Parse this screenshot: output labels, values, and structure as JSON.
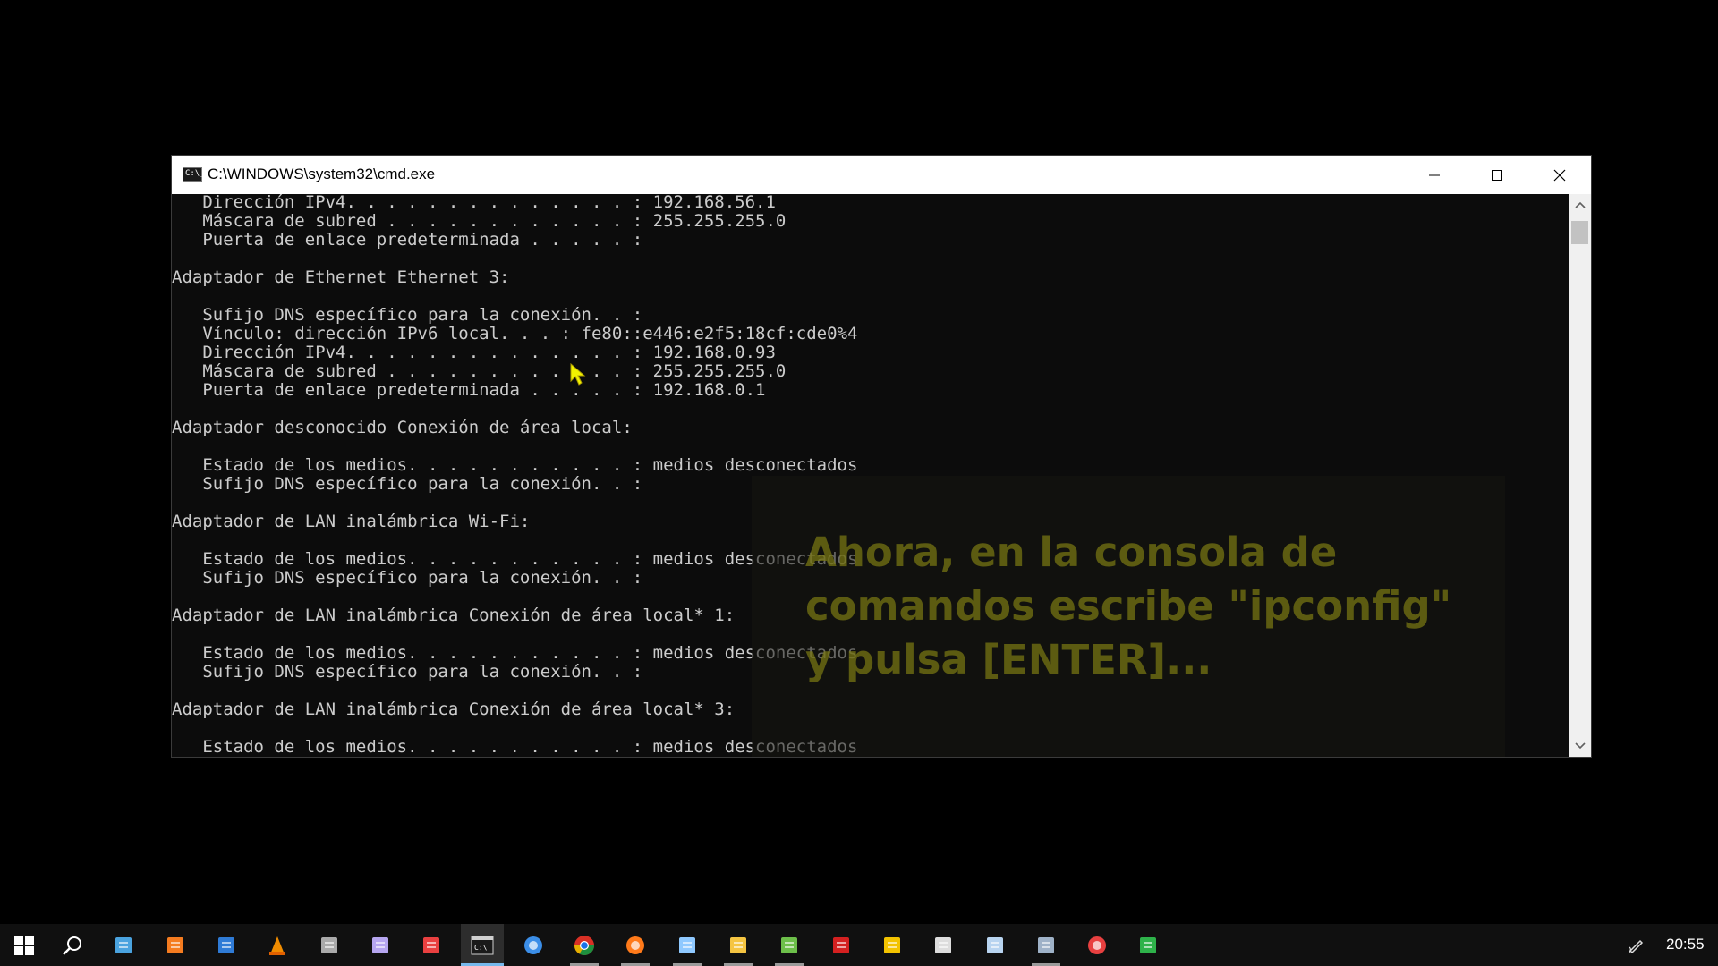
{
  "window": {
    "title": "C:\\WINDOWS\\system32\\cmd.exe",
    "icon_text": "C:\\_"
  },
  "console": {
    "lines": [
      "   Dirección IPv4. . . . . . . . . . . . . . : 192.168.56.1",
      "   Máscara de subred . . . . . . . . . . . . : 255.255.255.0",
      "   Puerta de enlace predeterminada . . . . . :",
      "",
      "Adaptador de Ethernet Ethernet 3:",
      "",
      "   Sufijo DNS específico para la conexión. . :",
      "   Vínculo: dirección IPv6 local. . . : fe80::e446:e2f5:18cf:cde0%4",
      "   Dirección IPv4. . . . . . . . . . . . . . : 192.168.0.93",
      "   Máscara de subred . . . . . . . . . . . . : 255.255.255.0",
      "   Puerta de enlace predeterminada . . . . . : 192.168.0.1",
      "",
      "Adaptador desconocido Conexión de área local:",
      "",
      "   Estado de los medios. . . . . . . . . . . : medios desconectados",
      "   Sufijo DNS específico para la conexión. . :",
      "",
      "Adaptador de LAN inalámbrica Wi-Fi:",
      "",
      "   Estado de los medios. . . . . . . . . . . : medios desconectados",
      "   Sufijo DNS específico para la conexión. . :",
      "",
      "Adaptador de LAN inalámbrica Conexión de área local* 1:",
      "",
      "   Estado de los medios. . . . . . . . . . . : medios desconectados",
      "   Sufijo DNS específico para la conexión. . :",
      "",
      "Adaptador de LAN inalámbrica Conexión de área local* 3:",
      "",
      "   Estado de los medios. . . . . . . . . . . : medios desconectados"
    ]
  },
  "overlay": {
    "caption_line1": "Ahora, en la consola de",
    "caption_line2": "comandos escribe \"ipconfig\"",
    "caption_line3": "y pulsa [ENTER]..."
  },
  "taskbar": {
    "items": [
      {
        "name": "start-icon",
        "color": "#ffffff"
      },
      {
        "name": "search-icon",
        "color": "#ffffff"
      },
      {
        "name": "explorer-app-icon",
        "color": "#4aa3df"
      },
      {
        "name": "xampp-icon",
        "color": "#f57c20"
      },
      {
        "name": "visual-studio-code-icon",
        "color": "#2f7bd6"
      },
      {
        "name": "vlc-icon",
        "color": "#f08c00"
      },
      {
        "name": "link-app-icon",
        "color": "#aaaaaa"
      },
      {
        "name": "vs-app-icon",
        "color": "#b6a6f0"
      },
      {
        "name": "bluetooth-app-icon",
        "color": "#e94040"
      },
      {
        "name": "cmd-icon",
        "color": "#d0d0d0"
      },
      {
        "name": "edge-app-icon",
        "color": "#3b8ee8"
      },
      {
        "name": "chrome-icon",
        "color": "#e6b000"
      },
      {
        "name": "firefox-icon",
        "color": "#ff7a1a"
      },
      {
        "name": "snipping-tool-icon",
        "color": "#8fc9ff"
      },
      {
        "name": "file-explorer-icon",
        "color": "#f5c542"
      },
      {
        "name": "notepad-app-icon",
        "color": "#6dbf4a"
      },
      {
        "name": "red-app-icon",
        "color": "#d42020"
      },
      {
        "name": "sticky-notes-icon",
        "color": "#f3c300"
      },
      {
        "name": "hammer-app-icon",
        "color": "#dddddd"
      },
      {
        "name": "virtualbox-icon",
        "color": "#b8d4f0"
      },
      {
        "name": "screenshot-app-icon",
        "color": "#9fb2c8"
      },
      {
        "name": "clock-app-icon",
        "color": "#e84040"
      },
      {
        "name": "spreadsheet-app-icon",
        "color": "#2eb24a"
      }
    ],
    "time": "20:55"
  }
}
